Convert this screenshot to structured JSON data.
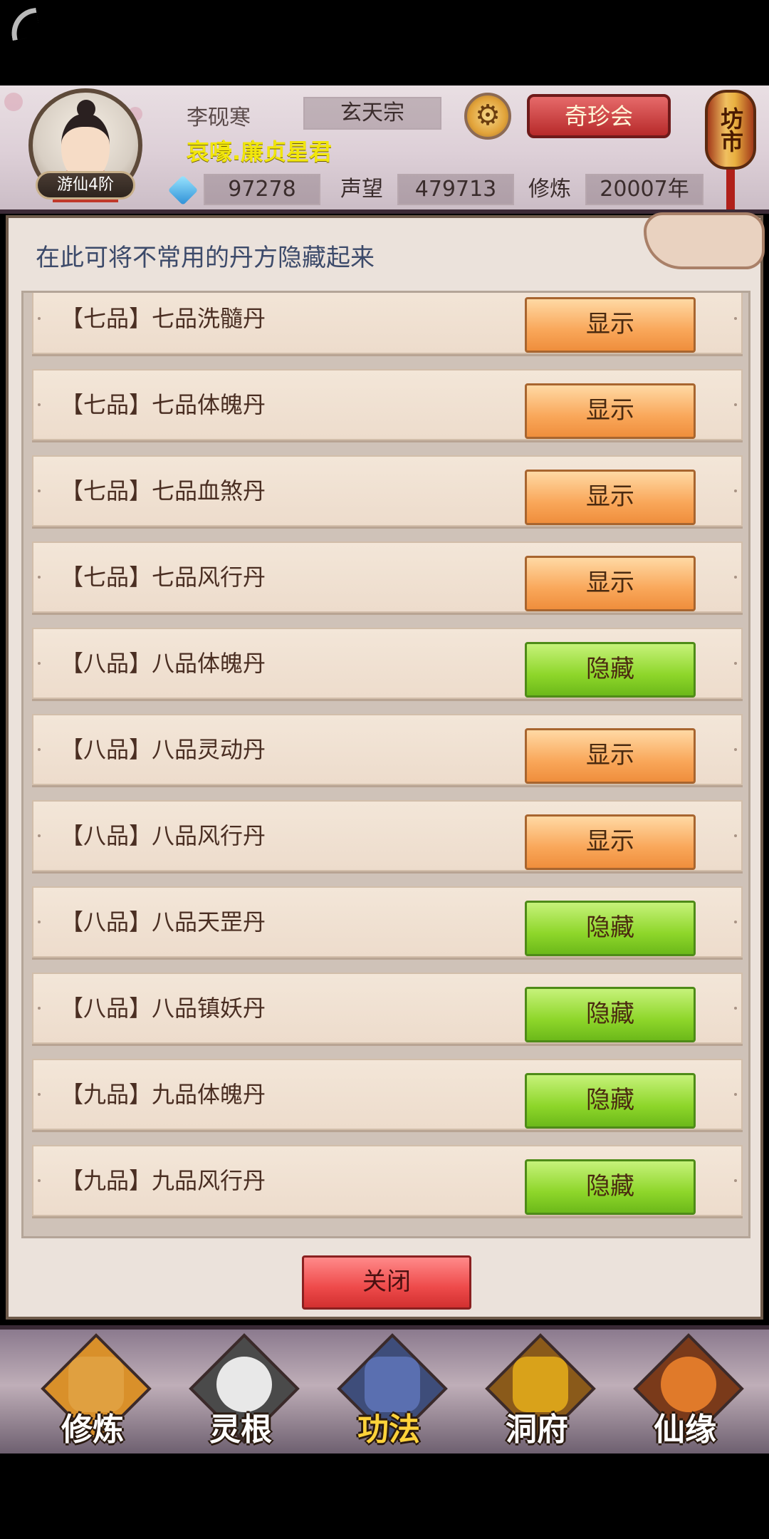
{
  "header": {
    "player_name": "李砚寒",
    "sect": "玄天宗",
    "market_button": "奇珍会",
    "title": "哀嚎.廉贞星君",
    "rank": "游仙4阶",
    "lantern_text": "坊市",
    "gems": "97278",
    "reputation_label": "声望",
    "reputation_value": "479713",
    "cultivation_label": "修炼",
    "cultivation_value": "20007年"
  },
  "panel": {
    "hint": "在此可将不常用的丹方隐藏起来",
    "rows": [
      {
        "label": "【七品】七品洗髓丹",
        "button": "显示",
        "state": "show"
      },
      {
        "label": "【七品】七品体魄丹",
        "button": "显示",
        "state": "show"
      },
      {
        "label": "【七品】七品血煞丹",
        "button": "显示",
        "state": "show"
      },
      {
        "label": "【七品】七品风行丹",
        "button": "显示",
        "state": "show"
      },
      {
        "label": "【八品】八品体魄丹",
        "button": "隐藏",
        "state": "hide"
      },
      {
        "label": "【八品】八品灵动丹",
        "button": "显示",
        "state": "show"
      },
      {
        "label": "【八品】八品风行丹",
        "button": "显示",
        "state": "show"
      },
      {
        "label": "【八品】八品天罡丹",
        "button": "隐藏",
        "state": "hide"
      },
      {
        "label": "【八品】八品镇妖丹",
        "button": "隐藏",
        "state": "hide"
      },
      {
        "label": "【九品】九品体魄丹",
        "button": "隐藏",
        "state": "hide"
      },
      {
        "label": "【九品】九品风行丹",
        "button": "隐藏",
        "state": "hide"
      }
    ],
    "close_button": "关闭"
  },
  "nav": [
    {
      "label": "修炼",
      "icon": "monk-icon",
      "color": "#d9902a"
    },
    {
      "label": "灵根",
      "icon": "yin-yang-icon",
      "color": "#e8e8e8"
    },
    {
      "label": "功法",
      "icon": "book-icon",
      "color": "#5a6fb0",
      "active": true
    },
    {
      "label": "洞府",
      "icon": "pagoda-icon",
      "color": "#d9a21a"
    },
    {
      "label": "仙缘",
      "icon": "gourd-icon",
      "color": "#e07a2a"
    }
  ]
}
